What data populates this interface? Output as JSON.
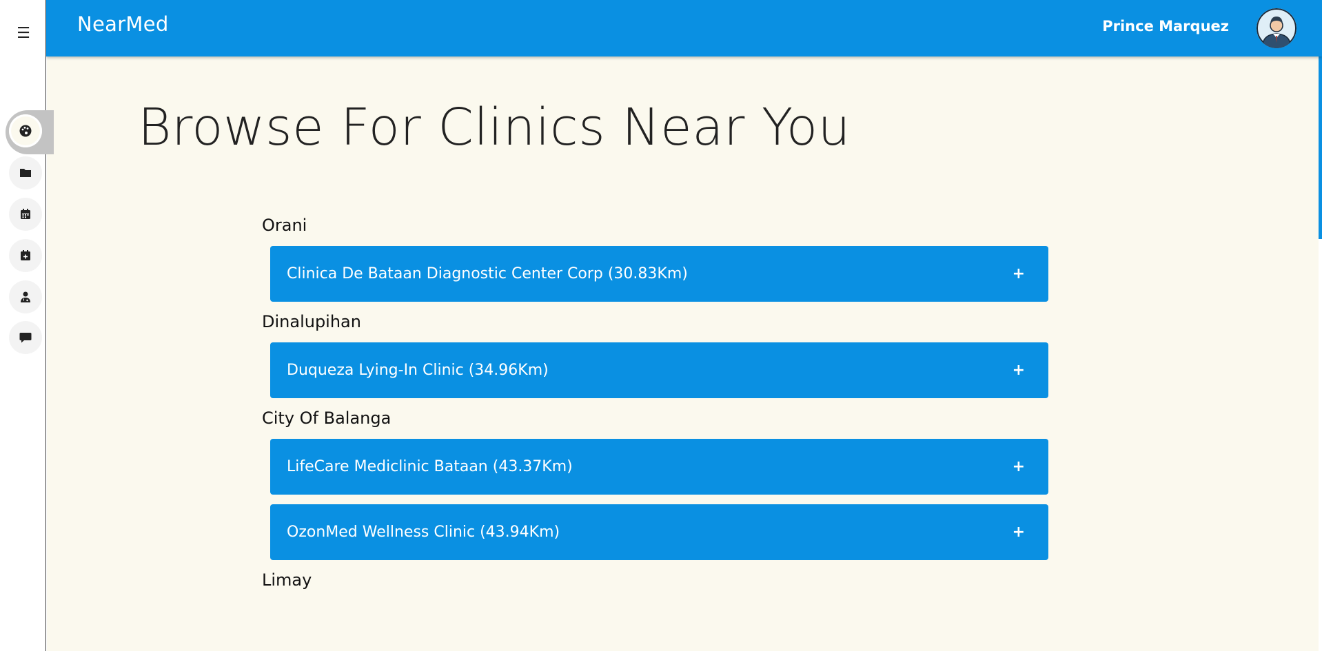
{
  "app": {
    "brand": "NearMed",
    "user_name": "Prince Marquez"
  },
  "sidebar": {
    "menu_icon": "hamburger-icon",
    "items": [
      {
        "name": "dashboard",
        "icon": "palette-icon",
        "active": true
      },
      {
        "name": "records",
        "icon": "folder-icon",
        "active": false
      },
      {
        "name": "calendar",
        "icon": "calendar-icon",
        "active": false
      },
      {
        "name": "appointments",
        "icon": "calendar-plus-icon",
        "active": false
      },
      {
        "name": "doctors",
        "icon": "user-doctor-icon",
        "active": false
      },
      {
        "name": "messages",
        "icon": "message-icon",
        "active": false
      }
    ]
  },
  "main": {
    "title": "Browse For Clinics Near You",
    "groups": [
      {
        "city": "Orani",
        "clinics": [
          {
            "label": "Clinica De Bataan Diagnostic Center Corp (30.83Km)"
          }
        ]
      },
      {
        "city": "Dinalupihan",
        "clinics": [
          {
            "label": "Duqueza Lying-In Clinic (34.96Km)"
          }
        ]
      },
      {
        "city": "City Of Balanga",
        "clinics": [
          {
            "label": "LifeCare Mediclinic Bataan (43.37Km)"
          },
          {
            "label": "OzonMed Wellness Clinic (43.94Km)"
          }
        ]
      },
      {
        "city": "Limay",
        "clinics": []
      }
    ],
    "expand_symbol": "+"
  },
  "colors": {
    "primary": "#0a90e2",
    "background": "#fbf9ee"
  }
}
